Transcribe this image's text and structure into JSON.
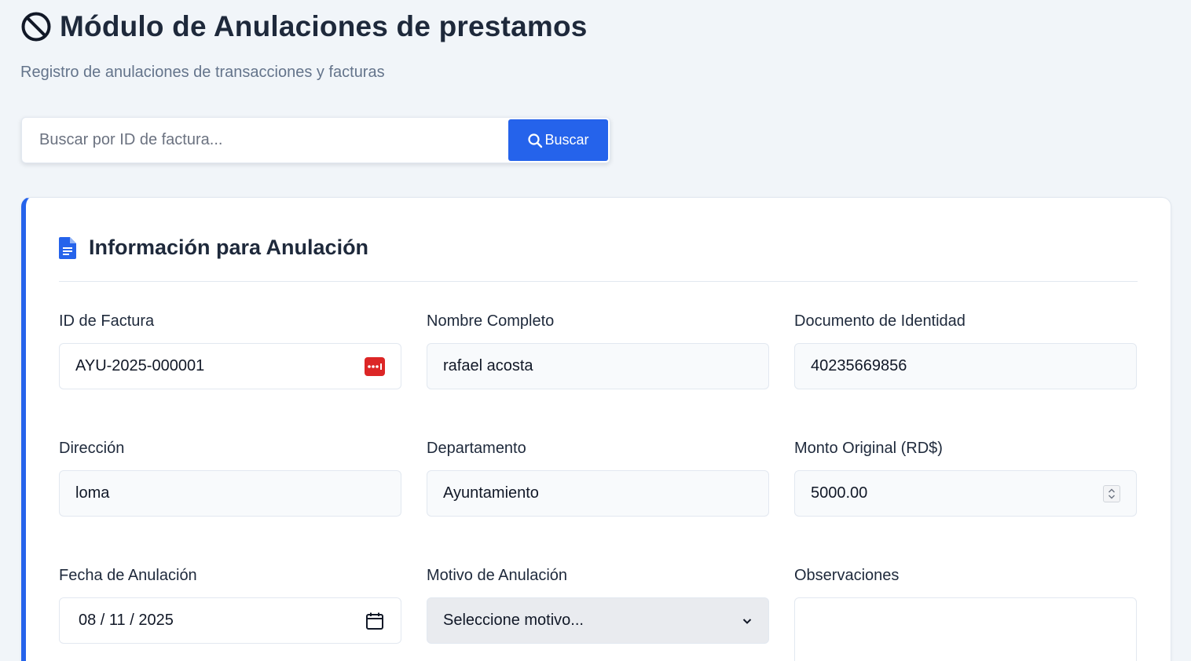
{
  "header": {
    "title": "Módulo de Anulaciones de prestamos",
    "subtitle": "Registro de anulaciones de transacciones y facturas"
  },
  "search": {
    "placeholder": "Buscar por ID de factura...",
    "button_label": "Buscar"
  },
  "card": {
    "title": "Información para Anulación",
    "fields": {
      "invoice_id": {
        "label": "ID de Factura",
        "value": "AYU-2025-000001"
      },
      "full_name": {
        "label": "Nombre Completo",
        "value": "rafael acosta"
      },
      "id_document": {
        "label": "Documento de Identidad",
        "value": "40235669856"
      },
      "address": {
        "label": "Dirección",
        "value": "loma"
      },
      "department": {
        "label": "Departamento",
        "value": "Ayuntamiento"
      },
      "original_amount": {
        "label": "Monto Original (RD$)",
        "value": "5000.00"
      },
      "cancel_date": {
        "label": "Fecha de Anulación",
        "value": "08 / 11 / 2025"
      },
      "cancel_reason": {
        "label": "Motivo de Anulación",
        "value": "Seleccione motivo..."
      },
      "observations": {
        "label": "Observaciones",
        "value": ""
      }
    }
  },
  "icons": {
    "title_icon": "ban-icon",
    "search_icon": "search-icon",
    "card_icon": "file-lines-icon",
    "password_icon": "password-dots-icon",
    "calendar_icon": "calendar-icon",
    "select_icon": "chevron-down-icon",
    "spinner_icon": "number-spinner-icon"
  },
  "colors": {
    "accent": "#2563eb",
    "background": "#f1f5f9",
    "password_badge": "#dc2626"
  }
}
